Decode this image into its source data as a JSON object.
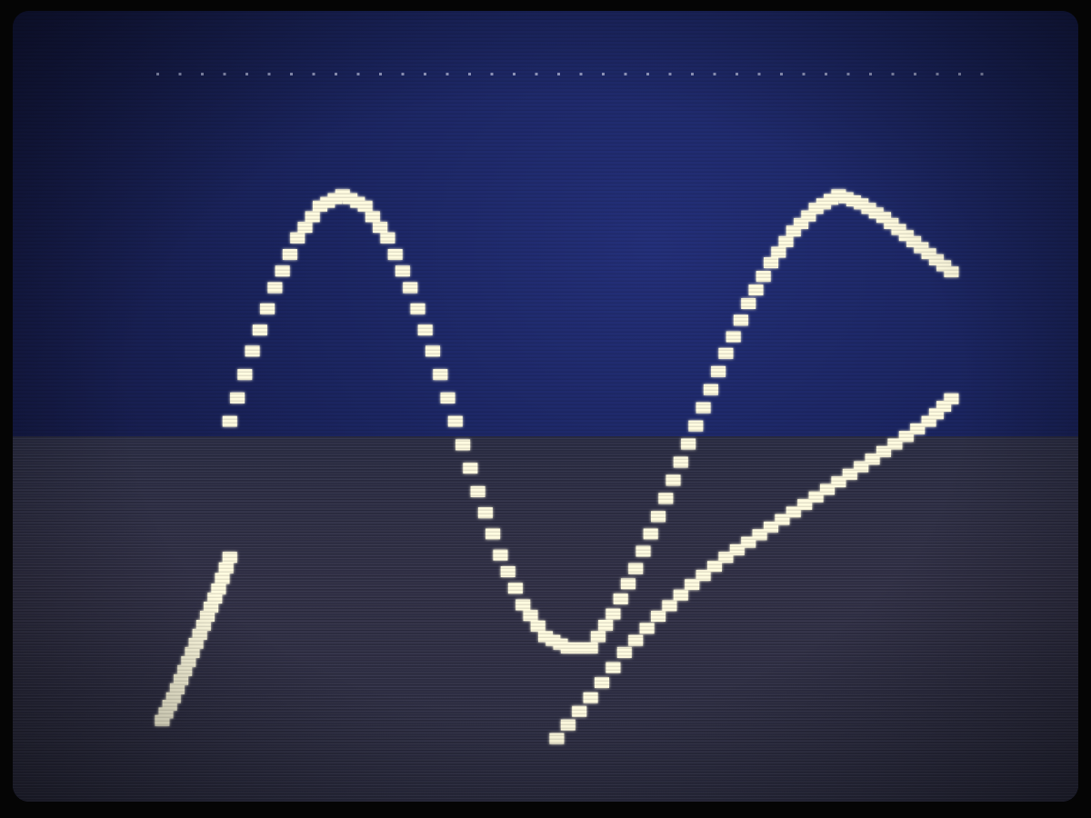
{
  "colors": {
    "phosphor": "#fffbe0",
    "axis": "#f6f1b8",
    "glow": "#e8d98a",
    "border_dots": "#9aa0c8"
  },
  "chart_data": {
    "type": "line",
    "title": "",
    "xlabel": "",
    "ylabel": "",
    "xlim": [
      -0.35,
      3.4
    ],
    "ylim": [
      -1.55,
      1.25
    ],
    "grid": false,
    "legend": "none",
    "series": [
      {
        "x": [
          0,
          0.1,
          0.2,
          0.3,
          0.4,
          0.5,
          0.6,
          0.7,
          0.8,
          0.9,
          1.0,
          1.1,
          1.2,
          1.3,
          1.4,
          1.5,
          1.6,
          1.7,
          1.8,
          1.9,
          2.0,
          2.1,
          2.2,
          2.3,
          2.4,
          2.5,
          2.6,
          2.7,
          2.8,
          2.9,
          3.0,
          3.1,
          3.2
        ],
        "y": [
          0,
          0.31,
          0.59,
          0.81,
          0.95,
          1.0,
          0.95,
          0.81,
          0.59,
          0.31,
          0,
          -0.31,
          -0.59,
          -0.81,
          -0.95,
          -1.0,
          -1.0,
          -0.85,
          -0.65,
          -0.42,
          -0.18,
          0.06,
          0.3,
          0.52,
          0.7,
          0.84,
          0.94,
          1.0,
          0.96,
          0.9,
          0.82,
          0.74,
          0.66
        ]
      },
      {
        "x": [
          -0.3,
          -0.25,
          -0.2,
          -0.15,
          -0.1,
          -0.05,
          0.0
        ],
        "y": [
          -1.32,
          -1.22,
          -1.1,
          -0.98,
          -0.86,
          -0.74,
          -0.6
        ]
      },
      {
        "x": [
          1.45,
          1.6,
          1.75,
          1.9,
          2.05,
          2.2,
          2.35,
          2.5,
          2.65,
          2.8,
          2.95,
          3.1,
          3.2
        ],
        "y": [
          -1.4,
          -1.22,
          -1.02,
          -0.86,
          -0.72,
          -0.6,
          -0.5,
          -0.4,
          -0.3,
          -0.2,
          -0.1,
          0.0,
          0.1
        ]
      }
    ]
  }
}
